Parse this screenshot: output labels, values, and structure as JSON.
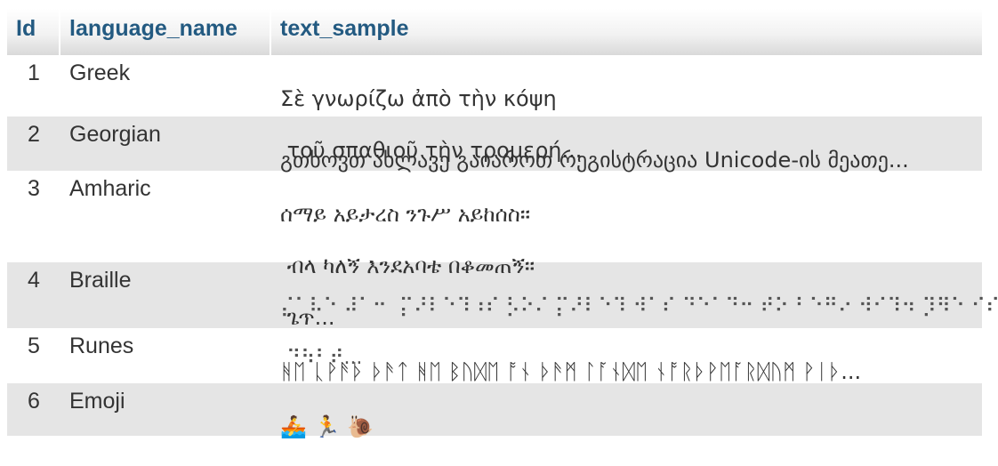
{
  "table": {
    "columns": [
      "Id",
      "language_name",
      "text_sample"
    ],
    "rows": [
      {
        "id": "1",
        "language_name": "Greek",
        "text_lines": [
          "Σὲ γνωρίζω ἀπὸ τὴν κόψη",
          " τοῦ σπαθιοῦ τὴν τρομερή..."
        ]
      },
      {
        "id": "2",
        "language_name": "Georgian",
        "text_lines": [
          "გთხოვთ ახლავე გაიაროთ რეგისტრაცია Unicode-ის მეათე..."
        ]
      },
      {
        "id": "3",
        "language_name": "Amharic",
        "text_lines": [
          "ሰማይ አይታረስ ንጉሥ አይከሰስ።",
          " ብላ ካለኝ እንደአባቴ በቆመጠኝ።",
          " ጌጥ..."
        ]
      },
      {
        "id": "4",
        "language_name": "Braille",
        "text_lines": [
          "⡌⠁⠧⠑ ⠼⠁⠒  ⡍⠜⠇⠑⠹⠰⠎ ⡣⠕⠌ ⡍⠜⠇⠑⠹ ⠺⠁⠎ ⠙⠑⠁⠙⠒ ⠞⠕ ⠃⠑⠛⠔ ⠺⠊⠹⠲ ⡹⠻⠑ ⠊⠎ ⠝⠕",
          " ⠙⠳⠃⠞..."
        ]
      },
      {
        "id": "5",
        "language_name": "Runes",
        "text_lines": [
          "ᚻᛖ ᚳᚹᚫᚦ ᚦᚫᛏ ᚻᛖ ᛒᚢᛞᛖ ᚩᚾ ᚦᚫᛗ ᛚᚪᚾᛞᛖ ᚾᚩᚱᚦᚹᛖᚪᚱᛞᚢᛗ ᚹᛁᚦ..."
        ]
      },
      {
        "id": "6",
        "language_name": "Emoji",
        "text_lines": [
          "🚣 🏃 🐌"
        ]
      }
    ]
  }
}
